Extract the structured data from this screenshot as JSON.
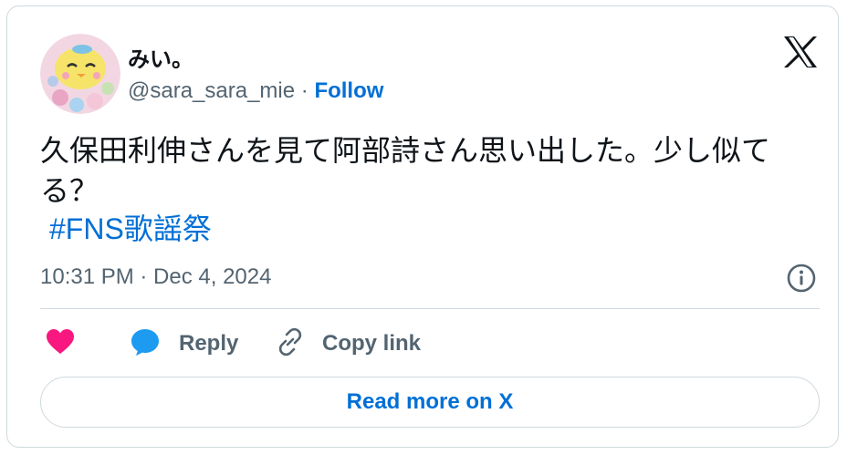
{
  "tweet": {
    "display_name": "みい。",
    "handle": "@sara_sara_mie",
    "separator": " · ",
    "follow_label": "Follow",
    "text": "久保田利伸さんを見て阿部詩さん思い出した。少し似てる？",
    "hashtag": "#FNS歌謡祭",
    "timestamp": "10:31 PM · Dec 4, 2024"
  },
  "actions": {
    "like_icon": "heart-icon",
    "reply_icon": "speech-bubble-icon",
    "reply_label": "Reply",
    "copy_icon": "link-icon",
    "copy_label": "Copy link"
  },
  "read_more_label": "Read more on X",
  "colors": {
    "link": "#006fd6",
    "like": "#f91880",
    "reply": "#1d9bf0",
    "secondary_text": "#536471",
    "border": "#cfd9de"
  }
}
